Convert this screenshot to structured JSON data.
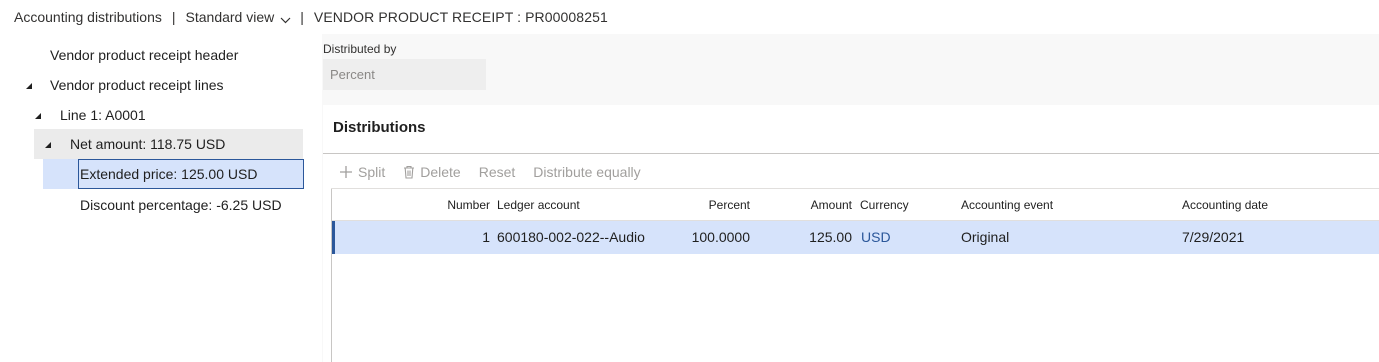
{
  "header": {
    "title": "Accounting distributions",
    "separator": "|",
    "view": "Standard view",
    "record": "VENDOR PRODUCT RECEIPT : PR00008251"
  },
  "tree": {
    "items": [
      {
        "label": "Vendor product receipt header"
      },
      {
        "label": "Vendor product receipt lines"
      },
      {
        "label": "Line 1: A0001"
      },
      {
        "label": "Net amount: 118.75 USD"
      },
      {
        "label": "Extended price: 125.00 USD"
      },
      {
        "label": "Discount percentage: -6.25 USD"
      }
    ]
  },
  "distributed_by": {
    "label": "Distributed by",
    "value": "Percent"
  },
  "distributions": {
    "title": "Distributions",
    "toolbar": {
      "split": "Split",
      "delete": "Delete",
      "reset": "Reset",
      "distribute": "Distribute equally"
    },
    "columns": {
      "number": "Number",
      "ledger": "Ledger account",
      "percent": "Percent",
      "amount": "Amount",
      "currency": "Currency",
      "event": "Accounting event",
      "date": "Accounting date"
    },
    "rows": [
      {
        "number": "1",
        "ledger": "600180-002-022--Audio",
        "percent": "100.0000",
        "amount": "125.00",
        "currency": "USD",
        "event": "Original",
        "date": "7/29/2021"
      }
    ]
  },
  "colors": {
    "accent": "#2b579a",
    "selection": "#d6e3fb",
    "disabled_text": "#a19f9d"
  },
  "icons": [
    "chevron-down-icon",
    "expanded-triangle-icon",
    "plus-icon",
    "trash-icon"
  ]
}
